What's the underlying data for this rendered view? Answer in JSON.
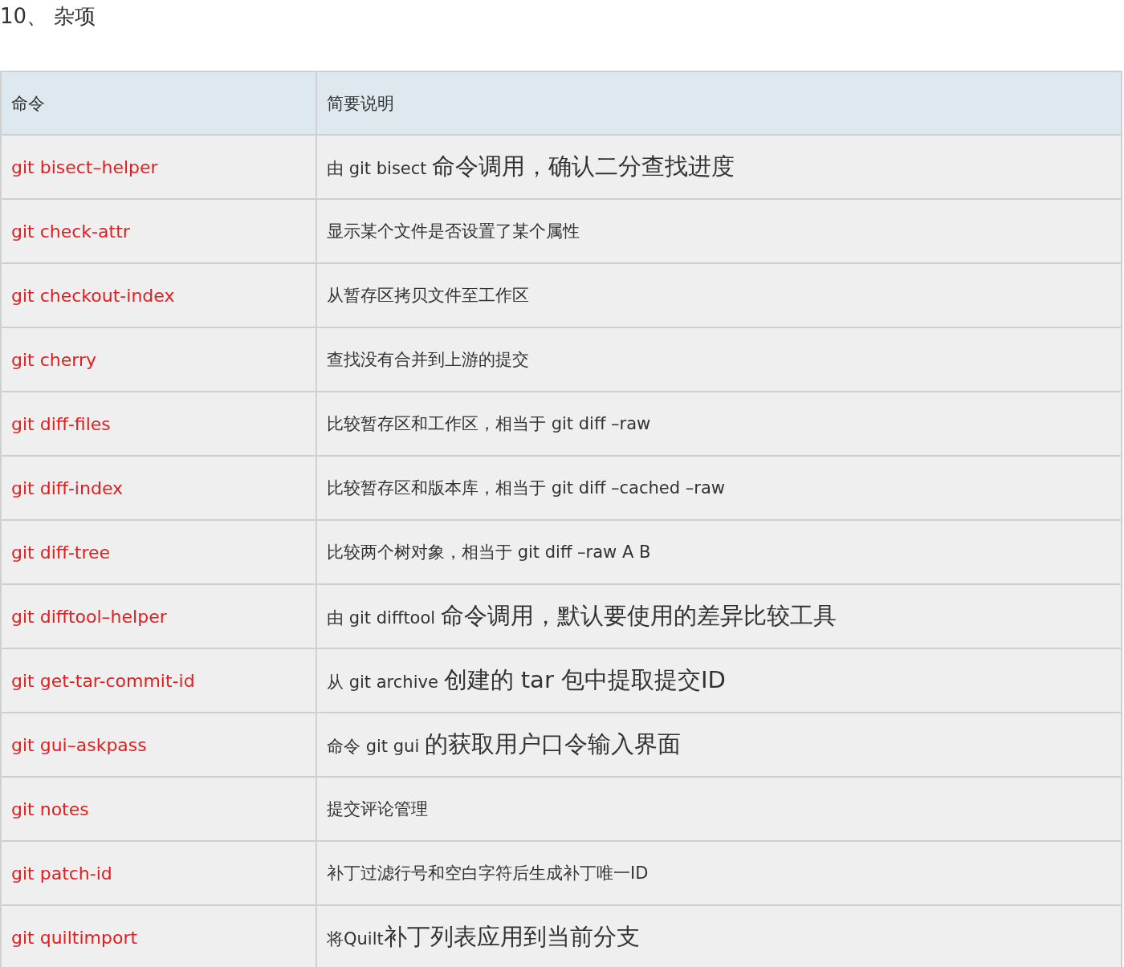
{
  "heading": "10、 杂项",
  "table": {
    "columns": [
      "命令",
      "简要说明"
    ],
    "rows": [
      {
        "command": "git bisect–helper",
        "description": [
          {
            "kind": "normal",
            "text": "由 git bisect "
          },
          {
            "kind": "large",
            "text": "命令调用，确认二分查找进度"
          }
        ]
      },
      {
        "command": "git check-attr",
        "description": [
          {
            "kind": "normal",
            "text": "显示某个文件是否设置了某个属性"
          }
        ]
      },
      {
        "command": "git checkout-index",
        "description": [
          {
            "kind": "normal",
            "text": "从暂存区拷贝文件至工作区"
          }
        ]
      },
      {
        "command": "git cherry",
        "description": [
          {
            "kind": "normal",
            "text": "查找没有合并到上游的提交"
          }
        ]
      },
      {
        "command": "git diff-files",
        "description": [
          {
            "kind": "normal",
            "text": "比较暂存区和工作区，相当于 git diff –raw"
          }
        ]
      },
      {
        "command": "git diff-index",
        "description": [
          {
            "kind": "normal",
            "text": "比较暂存区和版本库，相当于 git diff –cached –raw"
          }
        ]
      },
      {
        "command": "git diff-tree",
        "description": [
          {
            "kind": "normal",
            "text": "比较两个树对象，相当于 git diff –raw A B"
          }
        ]
      },
      {
        "command": "git difftool–helper",
        "description": [
          {
            "kind": "normal",
            "text": "由 git difftool "
          },
          {
            "kind": "large",
            "text": "命令调用，默认要使用的差异比较工具"
          }
        ]
      },
      {
        "command": "git get-tar-commit-id",
        "description": [
          {
            "kind": "normal",
            "text": "从 git archive "
          },
          {
            "kind": "large",
            "text": "创建的 tar 包中提取提交ID"
          }
        ]
      },
      {
        "command": "git gui–askpass",
        "description": [
          {
            "kind": "normal",
            "text": "命令 git gui "
          },
          {
            "kind": "large",
            "text": "的获取用户口令输入界面"
          }
        ]
      },
      {
        "command": "git notes",
        "description": [
          {
            "kind": "normal",
            "text": "提交评论管理"
          }
        ]
      },
      {
        "command": "git patch-id",
        "description": [
          {
            "kind": "normal",
            "text": "补丁过滤行号和空白字符后生成补丁唯一ID"
          }
        ]
      },
      {
        "command": "git quiltimport",
        "description": [
          {
            "kind": "normal",
            "text": "将Quilt"
          },
          {
            "kind": "large",
            "text": "补丁列表应用到当前分支"
          }
        ]
      }
    ]
  }
}
